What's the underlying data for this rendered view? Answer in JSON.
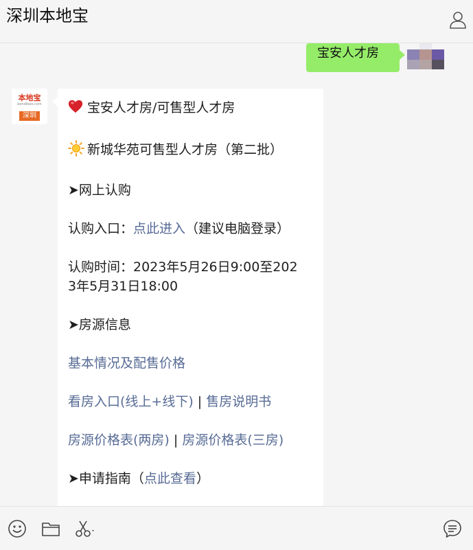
{
  "header": {
    "title": "深圳本地宝"
  },
  "chat": {
    "sent": {
      "text": "宝安人才房"
    },
    "bot_avatar": {
      "logo_top": "本地宝",
      "logo_domain": "bendibao.com",
      "logo_city": "深圳"
    },
    "message": {
      "line1": "宝安人才房/可售型人才房",
      "line2": "新城华苑可售型人才房（第二批）",
      "section1": "➤网上认购",
      "entry_label": "认购入口：",
      "entry_link": "点此进入",
      "entry_note": "（建议电脑登录）",
      "time_line1": "认购时间：2023年5月26日9:00至202",
      "time_line2": "3年5月31日18:00",
      "section2": "➤房源信息",
      "link_basic": "基本情况及配售价格",
      "link_view": "看房入口(线上+线下)",
      "sep1": " | ",
      "link_manual": "售房说明书",
      "link_price2": "房源价格表(两房)",
      "sep2": " | ",
      "link_price3": "房源价格表(三房)",
      "guide_prefix": "➤申请指南（",
      "guide_link": "点此查看",
      "guide_suffix": "）"
    }
  },
  "colors": {
    "sent_bubble": "#95ec69",
    "link": "#576b95",
    "background": "#f5f5f5"
  },
  "icons": {
    "header": [
      "profile-icon"
    ],
    "toolbar": [
      "emoji-icon",
      "folder-icon",
      "scissors-icon",
      "chat-history-icon"
    ]
  }
}
